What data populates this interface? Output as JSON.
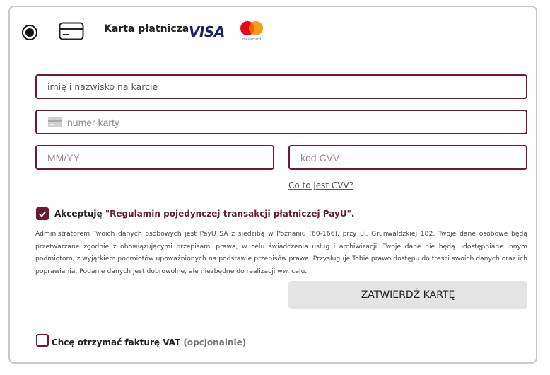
{
  "payment_method": {
    "label": "Karta płatnicza",
    "selected": true,
    "icons": [
      "credit-card-icon",
      "visa-logo",
      "mastercard-logo"
    ],
    "visa_text": "VISA",
    "mastercard_text": "mastercard"
  },
  "form": {
    "name_placeholder": "imię i nazwisko na karcie",
    "number_placeholder": "numer karty",
    "expiry_placeholder": "MM/YY",
    "cvv_placeholder": "kod CVV",
    "cvv_help_link": "Co to jest CVV?"
  },
  "terms": {
    "checked": true,
    "prefix": "Akceptuję ",
    "link_text": "\"Regulamin pojedynczej transakcji płatniczej PayU\"",
    "suffix": ".",
    "gdpr_text": "Administratorem Twoich danych osobowych jest PayU SA z siedzibą w Poznaniu (60-166), przy ul. Grunwaldzkiej 182. Twoje dane osobowe będą przetwarzane zgodnie z obowiązującymi przepisami prawa, w celu świadczenia usług i archiwizacji. Twoje dane nie będą udostępniane innym podmiotom, z wyjątkiem podmiotów upoważnionych na podstawie przepisów prawa. Przysługuje Tobie prawo dostępu do treści swoich danych oraz ich poprawiania. Podanie danych jest dobrowolne, ale niezbędne do realizacji ww. celu."
  },
  "submit_button": "ZATWIERDŹ KARTĘ",
  "vat": {
    "checked": false,
    "label": "Chcę otrzymać fakturę VAT",
    "optional": "(opcjonalnie)"
  },
  "colors": {
    "accent": "#6d1a36",
    "border": "#c9c9c9",
    "button_bg": "#e4e4e4",
    "visa_blue": "#1a1f71",
    "mc_red": "#eb001b",
    "mc_yellow": "#f79e1b"
  }
}
